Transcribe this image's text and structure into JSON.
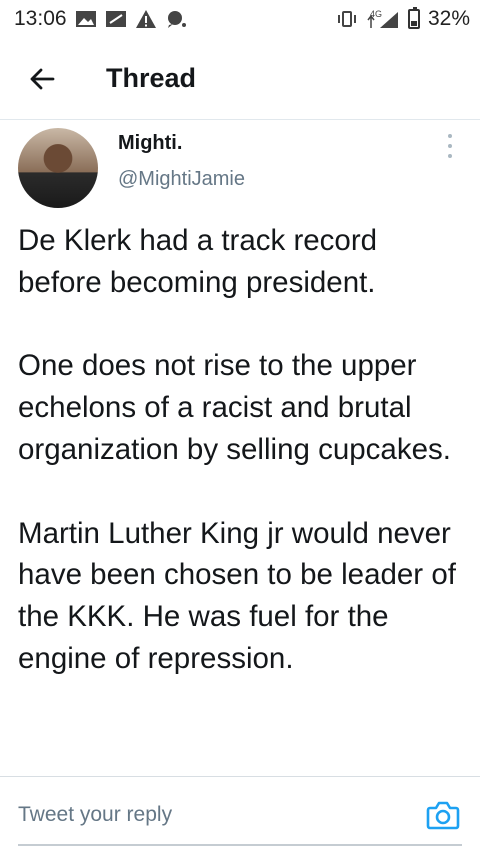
{
  "status_bar": {
    "time": "13:06",
    "network": "4G",
    "battery": "32%"
  },
  "app_bar": {
    "title": "Thread"
  },
  "tweet": {
    "display_name": "Mighti.",
    "handle": "@MightiJamie",
    "paragraphs": [
      "De Klerk had a track record before becoming president.",
      "One does not rise to the upper echelons of a racist and brutal organization by selling cupcakes.",
      "Martin Luther King jr would never have been chosen to be leader of the KKK. He was fuel for the engine of repression."
    ]
  },
  "reply": {
    "placeholder": "Tweet your reply"
  },
  "colors": {
    "accent": "#1da1f2",
    "text": "#14171a",
    "secondary": "#657786"
  }
}
